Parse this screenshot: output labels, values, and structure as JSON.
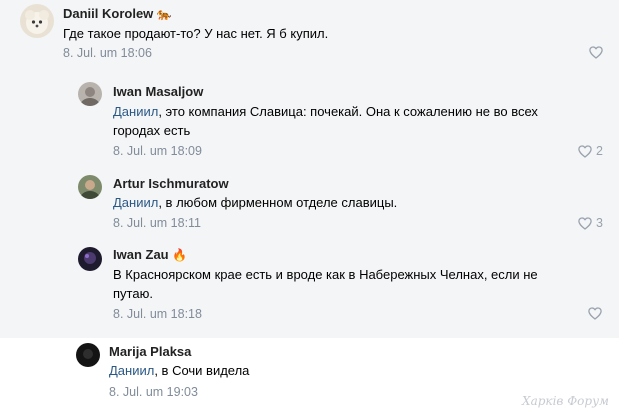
{
  "comments": [
    {
      "author": "Daniil Korolew",
      "author_emoji": "🐅",
      "mention": "",
      "text": "Где такое продают-то? У нас нет. Я б купил.",
      "date": "8. Jul. um 18:06",
      "likes": ""
    },
    {
      "author": "Iwan Masaljow",
      "author_emoji": "",
      "mention": "Даниил",
      "text": ", это компания Славица: почекай. Она к сожалению не во всех городах есть",
      "date": "8. Jul. um 18:09",
      "likes": "2"
    },
    {
      "author": "Artur Ischmuratow",
      "author_emoji": "",
      "mention": "Даниил",
      "text": ", в любом фирменном отделе славицы.",
      "date": "8. Jul. um 18:11",
      "likes": "3"
    },
    {
      "author": "Iwan Zau",
      "author_emoji": "🔥",
      "mention": "",
      "text": "В Красноярском крае есть и вроде как в Набережных Челнах, если не путаю.",
      "date": "8. Jul. um 18:18",
      "likes": ""
    },
    {
      "author": "Marija Plaksa",
      "author_emoji": "",
      "mention": "Даниил",
      "text": ", в Сочи видела",
      "date": "8. Jul. um 19:03",
      "likes": ""
    }
  ],
  "watermark": "Харків Форум",
  "colors": {
    "background": "#ffffff",
    "band": "#f4f5f7",
    "mention": "#2a5885",
    "meta": "#818c99",
    "icon": "#99a2ad"
  },
  "icons": {
    "like": "heart-outline-icon"
  }
}
